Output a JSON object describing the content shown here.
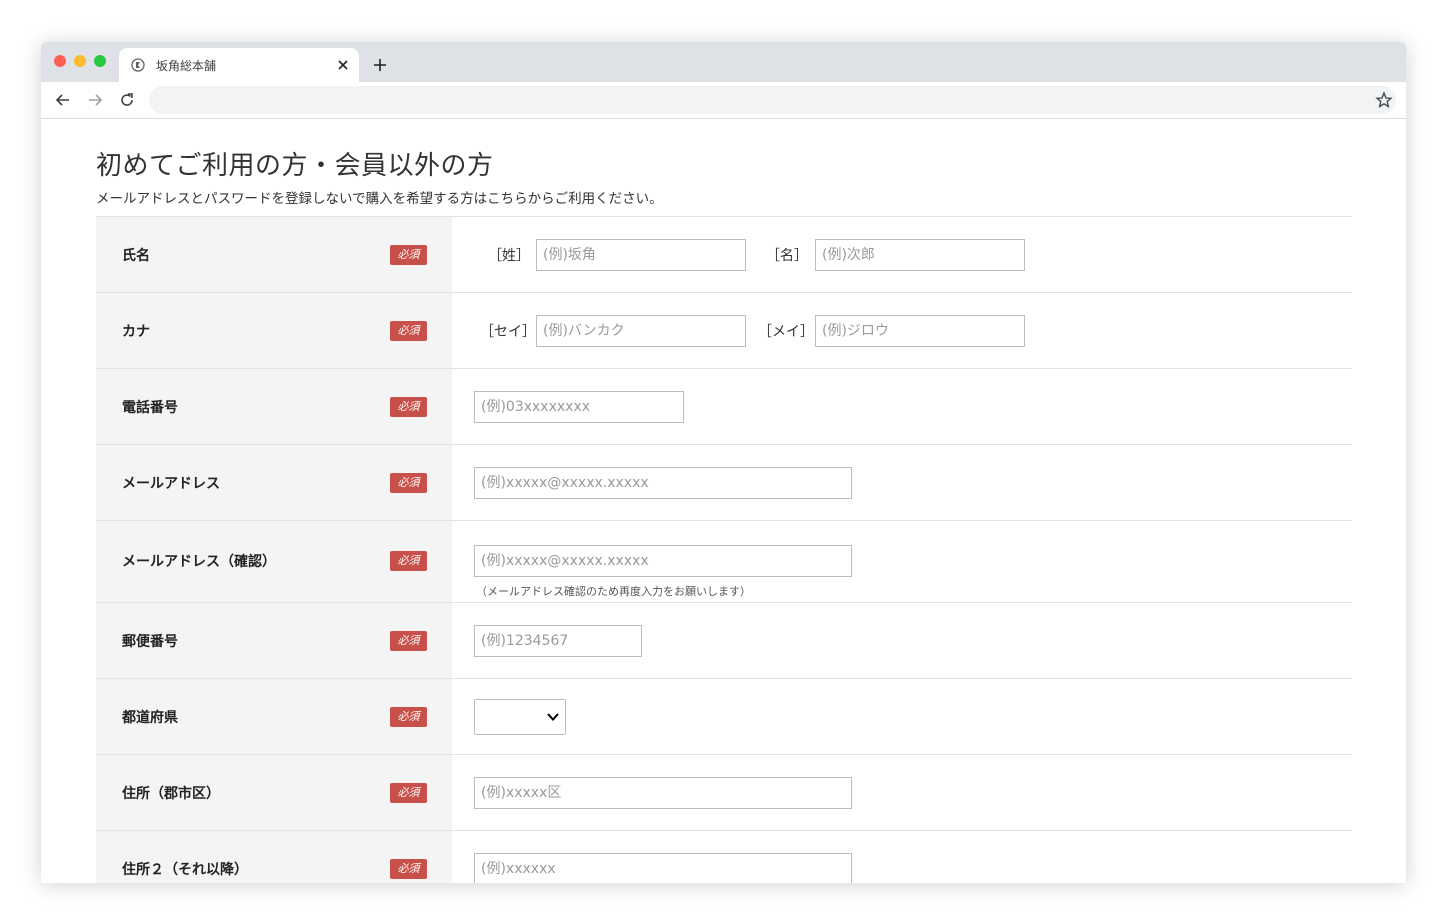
{
  "browser": {
    "tab_title": "坂角総本舗",
    "address": ""
  },
  "page": {
    "title": "初めてご利用の方・会員以外の方",
    "subtitle": "メールアドレスとパスワードを登録しないで購入を希望する方はこちらからご利用ください。"
  },
  "form": {
    "required_badge": "必須",
    "rows": {
      "name": {
        "label": "氏名",
        "sei_bracket": "［姓］",
        "sei_placeholder": "(例)坂角",
        "mei_bracket": "［名］",
        "mei_placeholder": "(例)次郎"
      },
      "kana": {
        "label": "カナ",
        "sei_bracket": "［セイ］",
        "sei_placeholder": "(例)バンカク",
        "mei_bracket": "［メイ］",
        "mei_placeholder": "(例)ジロウ"
      },
      "phone": {
        "label": "電話番号",
        "placeholder": "(例)03xxxxxxxx"
      },
      "email": {
        "label": "メールアドレス",
        "placeholder": "(例)xxxxx@xxxxx.xxxxx"
      },
      "email_confirm": {
        "label": "メールアドレス（確認）",
        "placeholder": "(例)xxxxx@xxxxx.xxxxx",
        "hint": "（メールアドレス確認のため再度入力をお願いします）"
      },
      "postal": {
        "label": "郵便番号",
        "placeholder": "(例)1234567"
      },
      "prefecture": {
        "label": "都道府県",
        "selected": ""
      },
      "address1": {
        "label": "住所（郡市区）",
        "placeholder": "(例)xxxxx区"
      },
      "address2": {
        "label": "住所２（それ以降）",
        "placeholder": "(例)xxxxxx"
      }
    }
  },
  "colors": {
    "badge": "#c8504a",
    "label_bg": "#f4f4f4",
    "tabbar": "#dee1e6"
  }
}
